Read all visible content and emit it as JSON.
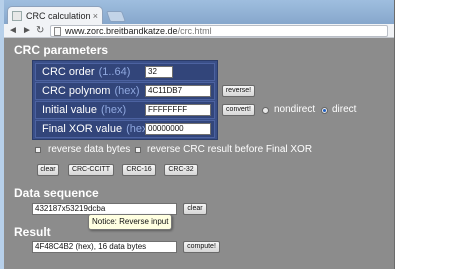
{
  "browser": {
    "tab_title": "CRC calculation",
    "tab_close": "×",
    "url_host": "www.zorc.breitbandkatze.de",
    "url_path": "/crc.html",
    "nav_back": "◄",
    "nav_forward": "►",
    "nav_reload": "↻"
  },
  "crc_parameters": {
    "title": "CRC parameters",
    "rows": [
      {
        "label": "CRC order",
        "hint": "(1..64)",
        "value": "32"
      },
      {
        "label": "CRC polynom",
        "hint": "(hex)",
        "value": "4C11DB7"
      },
      {
        "label": "Initial value",
        "hint": "(hex)",
        "value": "FFFFFFFF"
      },
      {
        "label": "Final XOR value",
        "hint": "(hex)",
        "value": "00000000"
      }
    ],
    "reverse_button": "reverse!",
    "convert_button": "convert!",
    "radio_nondirect": "nondirect",
    "radio_direct": "direct",
    "selected_mode": "direct",
    "checkbox_reverse_data": "reverse data bytes",
    "checkbox_reverse_crc": "reverse CRC result before Final XOR",
    "reverse_data_checked": false,
    "reverse_crc_checked": false,
    "preset_buttons": [
      "clear",
      "CRC-CCITT",
      "CRC-16",
      "CRC-32"
    ]
  },
  "data_sequence": {
    "title": "Data sequence",
    "value": "432187x53219dcba",
    "clear_button": "clear",
    "tooltip": "Notice: Reverse input"
  },
  "result": {
    "title": "Result",
    "value": "4F48C4B2 (hex), 16 data bytes",
    "compute_button": "compute!"
  },
  "colors": {
    "page_background": "#8c8c8c",
    "table_background": "#3a4f88",
    "hint_text": "#8fa8df"
  }
}
